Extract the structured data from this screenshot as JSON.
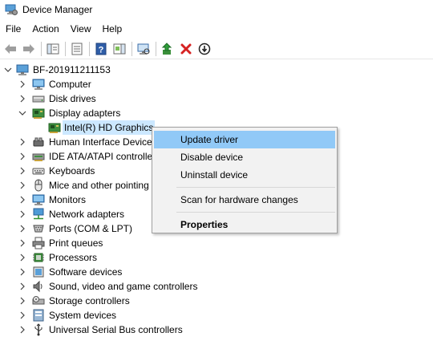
{
  "window": {
    "title": "Device Manager"
  },
  "menu": [
    "File",
    "Action",
    "View",
    "Help"
  ],
  "toolbar": [
    {
      "name": "back-icon"
    },
    {
      "name": "forward-icon"
    },
    {
      "name": "show-hide-console-tree-icon"
    },
    {
      "name": "properties-icon"
    },
    {
      "name": "help-icon"
    },
    {
      "name": "action-pane-icon"
    },
    {
      "name": "scan-hardware-icon"
    },
    {
      "name": "update-driver-icon"
    },
    {
      "name": "uninstall-device-icon"
    },
    {
      "name": "disable-device-icon"
    }
  ],
  "tree": {
    "root": "BF-201911211153",
    "categories": [
      {
        "label": "Computer",
        "icon": "computer-icon",
        "expanded": false
      },
      {
        "label": "Disk drives",
        "icon": "disk-drive-icon",
        "expanded": false
      },
      {
        "label": "Display adapters",
        "icon": "display-adapter-icon",
        "expanded": true,
        "children": [
          {
            "label": "Intel(R) HD Graphics",
            "icon": "display-adapter-icon",
            "selected": true
          }
        ]
      },
      {
        "label": "Human Interface Device",
        "icon": "hid-icon",
        "expanded": false
      },
      {
        "label": "IDE ATA/ATAPI controller",
        "icon": "ide-controller-icon",
        "expanded": false
      },
      {
        "label": "Keyboards",
        "icon": "keyboard-icon",
        "expanded": false
      },
      {
        "label": "Mice and other pointing",
        "icon": "mouse-icon",
        "expanded": false
      },
      {
        "label": "Monitors",
        "icon": "monitor-icon",
        "expanded": false
      },
      {
        "label": "Network adapters",
        "icon": "network-adapter-icon",
        "expanded": false
      },
      {
        "label": "Ports (COM & LPT)",
        "icon": "port-icon",
        "expanded": false
      },
      {
        "label": "Print queues",
        "icon": "printer-icon",
        "expanded": false
      },
      {
        "label": "Processors",
        "icon": "processor-icon",
        "expanded": false
      },
      {
        "label": "Software devices",
        "icon": "software-device-icon",
        "expanded": false
      },
      {
        "label": "Sound, video and game controllers",
        "icon": "sound-icon",
        "expanded": false
      },
      {
        "label": "Storage controllers",
        "icon": "storage-controller-icon",
        "expanded": false
      },
      {
        "label": "System devices",
        "icon": "system-device-icon",
        "expanded": false
      },
      {
        "label": "Universal Serial Bus controllers",
        "icon": "usb-icon",
        "expanded": false
      }
    ]
  },
  "context_menu": {
    "items": [
      {
        "label": "Update driver",
        "highlighted": true
      },
      {
        "label": "Disable device"
      },
      {
        "label": "Uninstall device"
      },
      {
        "separator": true
      },
      {
        "label": "Scan for hardware changes"
      },
      {
        "separator": true
      },
      {
        "label": "Properties",
        "bold": true
      }
    ]
  },
  "colors": {
    "selection": "#cce8ff",
    "menu_highlight": "#91c9f7",
    "menu_bg": "#f2f2f2"
  }
}
